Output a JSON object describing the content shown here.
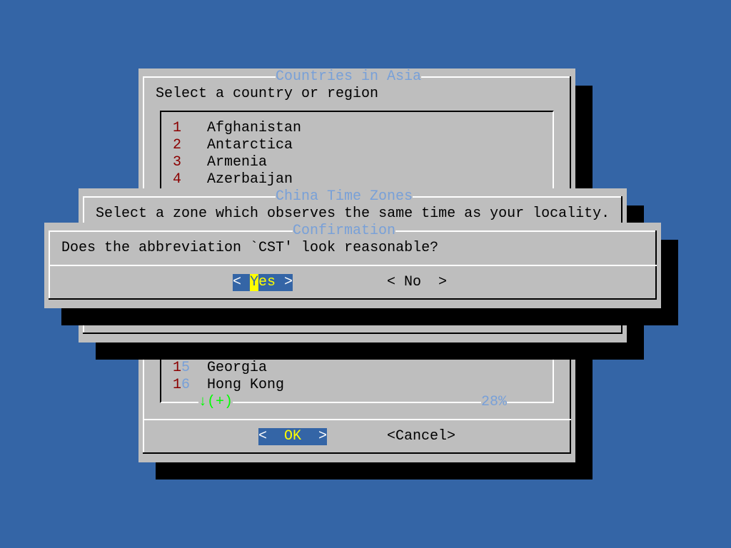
{
  "countries_dialog": {
    "title": "Countries in Asia",
    "prompt": "Select a country or region",
    "items_top": [
      {
        "num": "1",
        "label": "Afghanistan"
      },
      {
        "num": "2",
        "label": "Antarctica"
      },
      {
        "num": "3",
        "label": "Armenia"
      },
      {
        "num": "4",
        "label": "Azerbaijan"
      }
    ],
    "items_bottom": [
      {
        "num_a": "1",
        "num_b": "5",
        "label": "Georgia"
      },
      {
        "num_a": "1",
        "num_b": "6",
        "label": "Hong Kong"
      }
    ],
    "scroll_indicator": "↓(+)",
    "scroll_percent": "28%",
    "ok_label": "OK",
    "cancel_label": "<Cancel>"
  },
  "timezone_dialog": {
    "title": "China Time Zones",
    "prompt": "Select a zone which observes the same time as your locality."
  },
  "confirmation_dialog": {
    "title": "Confirmation",
    "question": "Does the abbreviation `CST' look reasonable?",
    "yes_hotkey": "Y",
    "yes_rest": "es",
    "no_label": "No"
  },
  "colors": {
    "background": "#3465a6",
    "panel": "#bebebe",
    "title": "#78a0d8",
    "hotkey": "#ffff00",
    "item_number": "#8b0000",
    "scroll_arrow": "#00ff00"
  }
}
